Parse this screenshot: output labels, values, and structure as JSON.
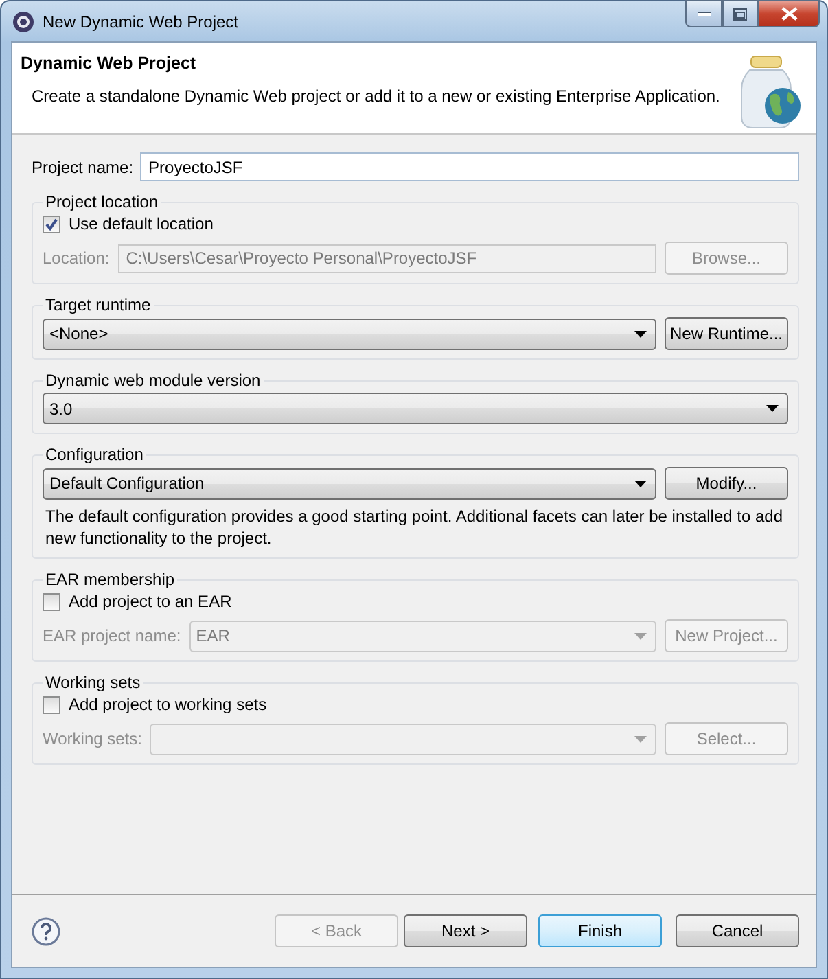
{
  "window": {
    "title": "New Dynamic Web Project"
  },
  "header": {
    "title": "Dynamic Web Project",
    "description": "Create a standalone Dynamic Web project or add it to a new or existing Enterprise Application."
  },
  "project_name": {
    "label": "Project name:",
    "value": "ProyectoJSF"
  },
  "project_location": {
    "title": "Project location",
    "use_default": {
      "label": "Use default location",
      "checked": true
    },
    "location": {
      "label": "Location:",
      "value": "C:\\Users\\Cesar\\Proyecto Personal\\ProyectoJSF",
      "disabled": true
    },
    "browse": {
      "label": "Browse...",
      "disabled": true
    }
  },
  "target_runtime": {
    "title": "Target runtime",
    "value": "<None>",
    "button": {
      "label": "New Runtime...",
      "disabled": false
    }
  },
  "module_version": {
    "title": "Dynamic web module version",
    "value": "3.0"
  },
  "configuration": {
    "title": "Configuration",
    "value": "Default Configuration",
    "button": {
      "label": "Modify...",
      "disabled": false
    },
    "description": "The default configuration provides a good starting point. Additional facets can later be installed to add new functionality to the project."
  },
  "ear_membership": {
    "title": "EAR membership",
    "add": {
      "label": "Add project to an EAR",
      "checked": false
    },
    "project_name": {
      "label": "EAR project name:",
      "value": "EAR",
      "disabled": true
    },
    "button": {
      "label": "New Project...",
      "disabled": true
    }
  },
  "working_sets": {
    "title": "Working sets",
    "add": {
      "label": "Add project to working sets",
      "checked": false
    },
    "sets": {
      "label": "Working sets:",
      "disabled": true
    },
    "button": {
      "label": "Select...",
      "disabled": true
    }
  },
  "buttons": [
    {
      "label": "< Back",
      "disabled": true,
      "default": false
    },
    {
      "label": "Next >",
      "disabled": false,
      "default": false
    },
    {
      "label": "Finish",
      "disabled": false,
      "default": true
    },
    {
      "label": "Cancel",
      "disabled": false,
      "default": false
    }
  ]
}
